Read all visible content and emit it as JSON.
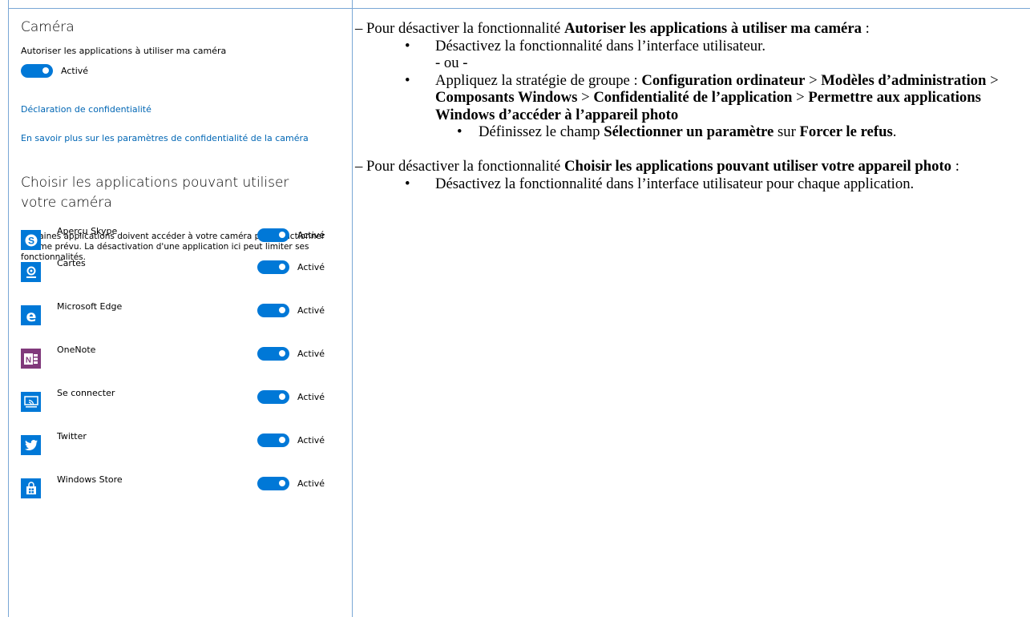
{
  "settings": {
    "title": "Caméra",
    "allow_label": "Autoriser les applications à utiliser ma caméra",
    "toggle_state": "Activé",
    "privacy_link": "Déclaration de confidentialité",
    "learn_more_link": "En savoir plus sur les paramètres de confidentialité de la caméra",
    "choose_heading": "Choisir les applications pouvant utiliser votre caméra",
    "choose_desc": "Certaines applications doivent accéder à votre caméra pour fonctionner comme prévu. La désactivation d'une application ici peut limiter ses fonctionnalités.",
    "apps": [
      {
        "name": "Aperçu Skype",
        "state": "Activé",
        "icon": "skype-icon",
        "color": "#0078d7"
      },
      {
        "name": "Cartes",
        "state": "Activé",
        "icon": "maps-icon",
        "color": "#0078d7"
      },
      {
        "name": "Microsoft Edge",
        "state": "Activé",
        "icon": "edge-icon",
        "color": "#0078d7"
      },
      {
        "name": "OneNote",
        "state": "Activé",
        "icon": "onenote-icon",
        "color": "#80397b"
      },
      {
        "name": "Se connecter",
        "state": "Activé",
        "icon": "connect-icon",
        "color": "#0078d7"
      },
      {
        "name": "Twitter",
        "state": "Activé",
        "icon": "twitter-icon",
        "color": "#0078d7"
      },
      {
        "name": "Windows Store",
        "state": "Activé",
        "icon": "store-icon",
        "color": "#0078d7"
      }
    ],
    "accent": "#0078d7"
  },
  "doc": {
    "p1_intro": "– Pour désactiver la fonctionnalité ",
    "p1_bold": "Autoriser les applications à utiliser ma caméra",
    "p1_end": " :",
    "b1": "Désactivez la fonctionnalité dans l’interface utilisateur.",
    "ou": "- ou -",
    "b2_intro": "Appliquez la stratégie de groupe : ",
    "b2_1": "Configuration ordinateur",
    "b2_sep": " > ",
    "b2_2": "Modèles d’administration",
    "b2_3": "Composants Windows",
    "b2_4": "Confidentialité de l’application",
    "b2_5": "Permettre aux applications Windows d’accéder à l’appareil photo",
    "sub_intro": "Définissez le champ ",
    "sub_bold1": "Sélectionner un paramètre",
    "sub_mid": " sur ",
    "sub_bold2": "Forcer le refus",
    "sub_end": ".",
    "p2_intro": "– Pour désactiver la fonctionnalité ",
    "p2_bold": "Choisir les applications pouvant utiliser votre appareil photo",
    "p2_end": " :",
    "b3": "Désactivez la fonctionnalité dans l’interface utilisateur pour chaque application.",
    "bullet_char": "•"
  }
}
